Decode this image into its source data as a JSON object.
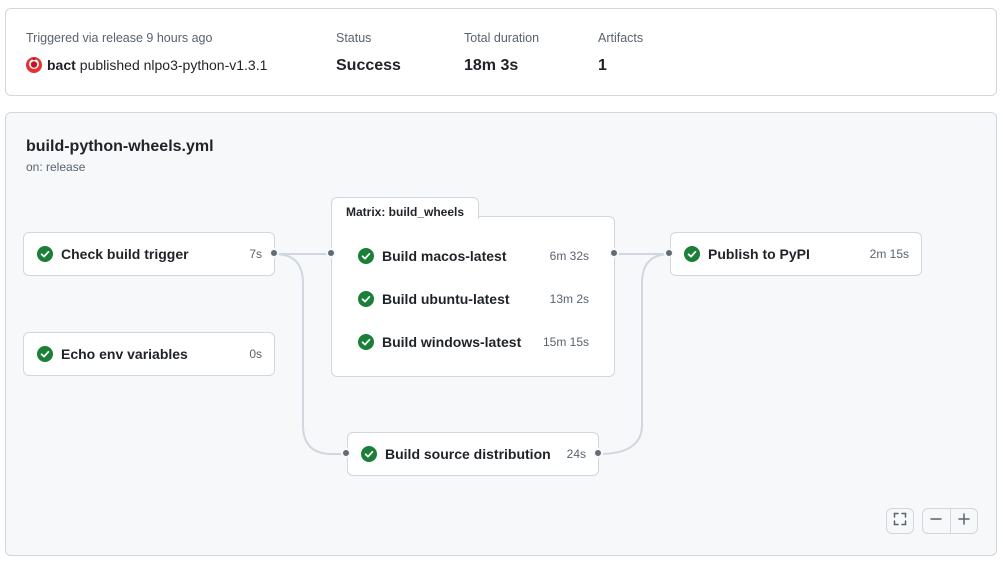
{
  "summary": {
    "trigger_label": "Triggered via release 9 hours ago",
    "actor": "bact",
    "action_text": "published nlpo3-python-v1.3.1",
    "status_label": "Status",
    "status_value": "Success",
    "duration_label": "Total duration",
    "duration_value": "18m 3s",
    "artifacts_label": "Artifacts",
    "artifacts_value": "1"
  },
  "workflow": {
    "file": "build-python-wheels.yml",
    "trigger": "on: release"
  },
  "jobs": {
    "check_build_trigger": {
      "name": "Check build trigger",
      "duration": "7s",
      "status": "success"
    },
    "echo_env": {
      "name": "Echo env variables",
      "duration": "0s",
      "status": "success"
    },
    "publish": {
      "name": "Publish to PyPI",
      "duration": "2m 15s",
      "status": "success"
    },
    "sdist": {
      "name": "Build source distribution",
      "duration": "24s",
      "status": "success"
    }
  },
  "matrix": {
    "title": "Matrix: build_wheels",
    "items": [
      {
        "name": "Build macos-latest",
        "duration": "6m 32s",
        "status": "success"
      },
      {
        "name": "Build ubuntu-latest",
        "duration": "13m 2s",
        "status": "success"
      },
      {
        "name": "Build windows-latest",
        "duration": "15m 15s",
        "status": "success"
      }
    ]
  },
  "colors": {
    "success": "#1a7f37",
    "edge": "#d0d7de",
    "dot": "#636c76"
  },
  "icons": {
    "status": "check-circle-fill-icon",
    "fullscreen": "fullscreen-icon",
    "zoom_out": "minus-icon",
    "zoom_in": "plus-icon",
    "avatar": "user-avatar"
  }
}
